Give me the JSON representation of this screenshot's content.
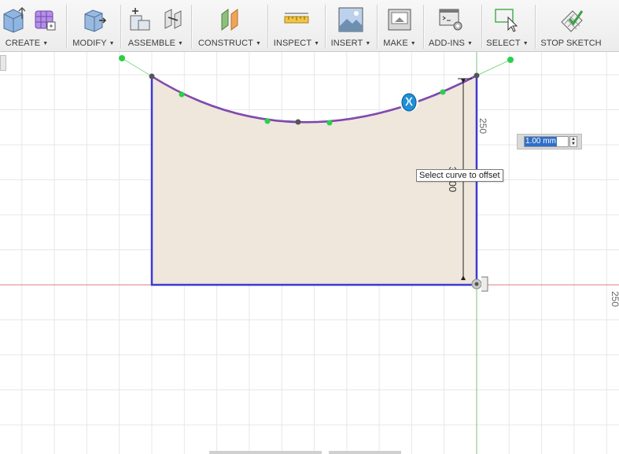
{
  "toolbar": {
    "groups": [
      {
        "id": "create",
        "label": "CREATE"
      },
      {
        "id": "modify",
        "label": "MODIFY"
      },
      {
        "id": "assemble",
        "label": "ASSEMBLE"
      },
      {
        "id": "construct",
        "label": "CONSTRUCT"
      },
      {
        "id": "inspect",
        "label": "INSPECT"
      },
      {
        "id": "insert",
        "label": "INSERT"
      },
      {
        "id": "make",
        "label": "MAKE"
      },
      {
        "id": "addins",
        "label": "ADD-INS"
      },
      {
        "id": "select",
        "label": "SELECT"
      },
      {
        "id": "stop",
        "label": "STOP SKETCH"
      }
    ],
    "caret": "▼"
  },
  "canvas": {
    "dimension_vertical": "36.00",
    "ruler_label_top": "250",
    "ruler_label_right": "250",
    "tooltip": "Select curve to offset",
    "offset_value": "1.00 mm"
  },
  "colors": {
    "profile_fill": "#efe6dc",
    "profile_stroke": "#3a3ad6",
    "offset_preview": "#c04a7a",
    "grid": "#e7e7e7",
    "axis_x": "#e07b7b",
    "axis_y": "#7fc07f",
    "handle": "#2ad04b",
    "selection": "#2f6fc8"
  }
}
